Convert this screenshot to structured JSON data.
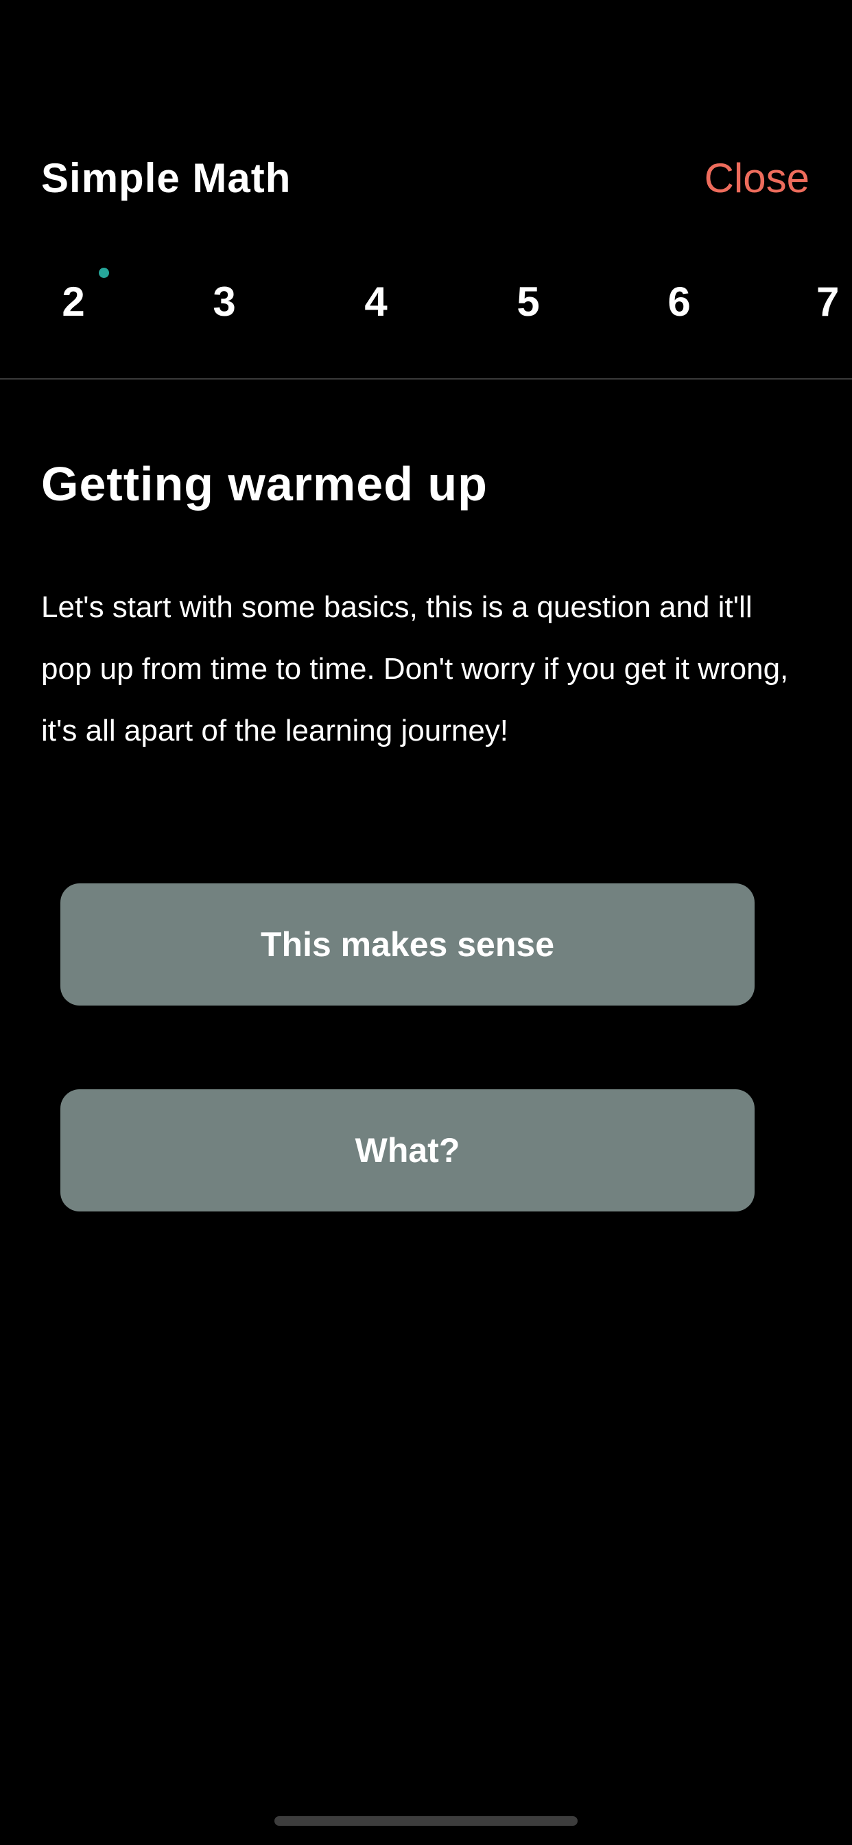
{
  "header": {
    "title": "Simple Math",
    "close_label": "Close"
  },
  "stepper": {
    "steps": [
      "2",
      "3",
      "4",
      "5",
      "6",
      "7"
    ],
    "active_step": "2"
  },
  "lesson": {
    "title": "Getting warmed up",
    "body": "Let's start with some basics, this is a question and it'll pop up from time to time. Don't worry if you get it wrong, it's all apart of the learning journey!"
  },
  "answers": [
    {
      "label": "This makes sense"
    },
    {
      "label": "What?"
    }
  ],
  "colors": {
    "accent_close": "#ee6c5c",
    "step_dot": "#26a69a",
    "button_bg": "#738280",
    "background": "#000000"
  }
}
